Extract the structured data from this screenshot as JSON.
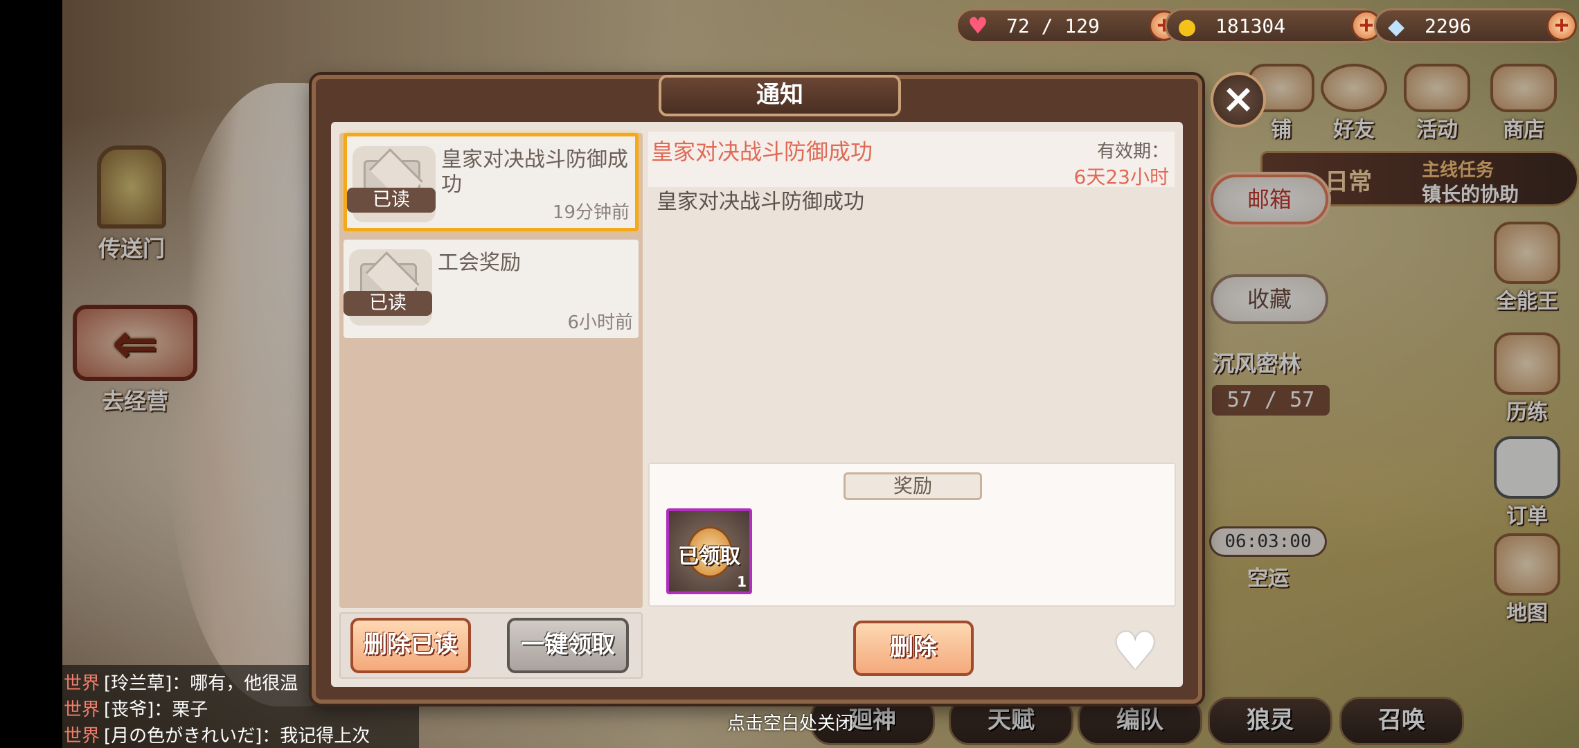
{
  "resources": {
    "stamina": "72 / 129",
    "gold": "181304",
    "crystal": "2296"
  },
  "left_buttons": {
    "portal": "传送门",
    "go_manage": "去经营"
  },
  "right_icons": {
    "shop_partial": "铺",
    "friends": "好友",
    "event": "活动",
    "store": "商店",
    "allrounder": "全能王",
    "training": "历练",
    "orders": "订单",
    "map": "地图"
  },
  "quest": {
    "daily": "日常",
    "main_title": "主线任务",
    "main_sub": "镇长的协助"
  },
  "side_tabs": {
    "mailbox": "邮箱",
    "favorites": "收藏"
  },
  "forest": {
    "name": "沉风密林",
    "count": "57 / 57"
  },
  "airship": {
    "timer": "06:03:00",
    "label": "空运"
  },
  "bottom_nav": [
    "...",
    "...",
    "天赋",
    "编队",
    "狼灵",
    "召唤"
  ],
  "bottom_nav_visible": [
    "廻神",
    "天赋",
    "编队",
    "狼灵",
    "召唤"
  ],
  "chat": [
    {
      "channel": "世界",
      "text": "[玲兰草]：哪有，他很温"
    },
    {
      "channel": "世界",
      "text": "[丧爷]：栗子"
    },
    {
      "channel": "世界",
      "text": "[月の色がきれいだ]：我记得上次"
    }
  ],
  "close_hint": "点击空白处关闭",
  "modal": {
    "title": "通知",
    "mails": [
      {
        "title": "皇家对决战斗防御成功",
        "status": "已读",
        "time": "19分钟前",
        "selected": true
      },
      {
        "title": "工会奖励",
        "status": "已读",
        "time": "6小时前",
        "selected": false
      }
    ],
    "delete_read_label": "删除已读",
    "claim_all_label": "一键领取",
    "detail": {
      "title": "皇家对决战斗防御成功",
      "validity_label": "有效期：",
      "validity_value": "6天23小时",
      "body": "皇家对决战斗防御成功",
      "reward_label": "奖励",
      "reward_status": "已领取",
      "reward_qty": "1",
      "delete_label": "删除"
    }
  },
  "colors": {
    "accent_red": "#e06a55",
    "selected_border": "#f4a81c",
    "reward_border": "#b12fbf"
  }
}
